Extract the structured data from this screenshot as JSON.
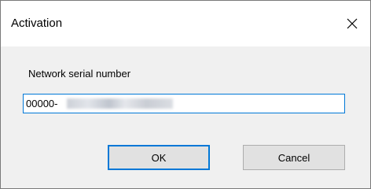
{
  "window": {
    "title": "Activation",
    "close_icon": "close-icon"
  },
  "form": {
    "serial_label": "Network serial number",
    "serial_value": "00000-",
    "serial_redacted": true
  },
  "buttons": {
    "ok_label": "OK",
    "cancel_label": "Cancel"
  },
  "colors": {
    "accent": "#0078d7",
    "dialog_bg": "#f0f0f0",
    "button_bg": "#e1e1e1"
  }
}
